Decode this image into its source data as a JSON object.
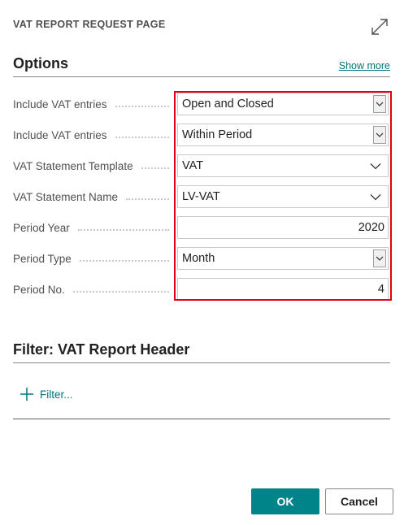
{
  "dialog": {
    "title": "VAT REPORT REQUEST PAGE",
    "expand_icon": "expand-arrows-icon"
  },
  "options": {
    "title": "Options",
    "show_more": "Show more",
    "fields": [
      {
        "label": "Include VAT entries",
        "value": "Open and Closed",
        "control": "select-box"
      },
      {
        "label": "Include VAT entries",
        "value": "Within Period",
        "control": "select-box"
      },
      {
        "label": "VAT Statement Template",
        "value": "VAT",
        "control": "lookup"
      },
      {
        "label": "VAT Statement Name",
        "value": "LV-VAT",
        "control": "lookup"
      },
      {
        "label": "Period Year",
        "value": "2020",
        "control": "number"
      },
      {
        "label": "Period Type",
        "value": "Month",
        "control": "select-box"
      },
      {
        "label": "Period No.",
        "value": "4",
        "control": "number"
      }
    ]
  },
  "filter": {
    "title": "Filter: VAT Report Header",
    "add_filter": "Filter...",
    "add_icon": "plus-icon"
  },
  "footer": {
    "ok": "OK",
    "cancel": "Cancel"
  },
  "colors": {
    "accent": "#008489",
    "link": "#00757a",
    "highlight": "#e3000f"
  }
}
